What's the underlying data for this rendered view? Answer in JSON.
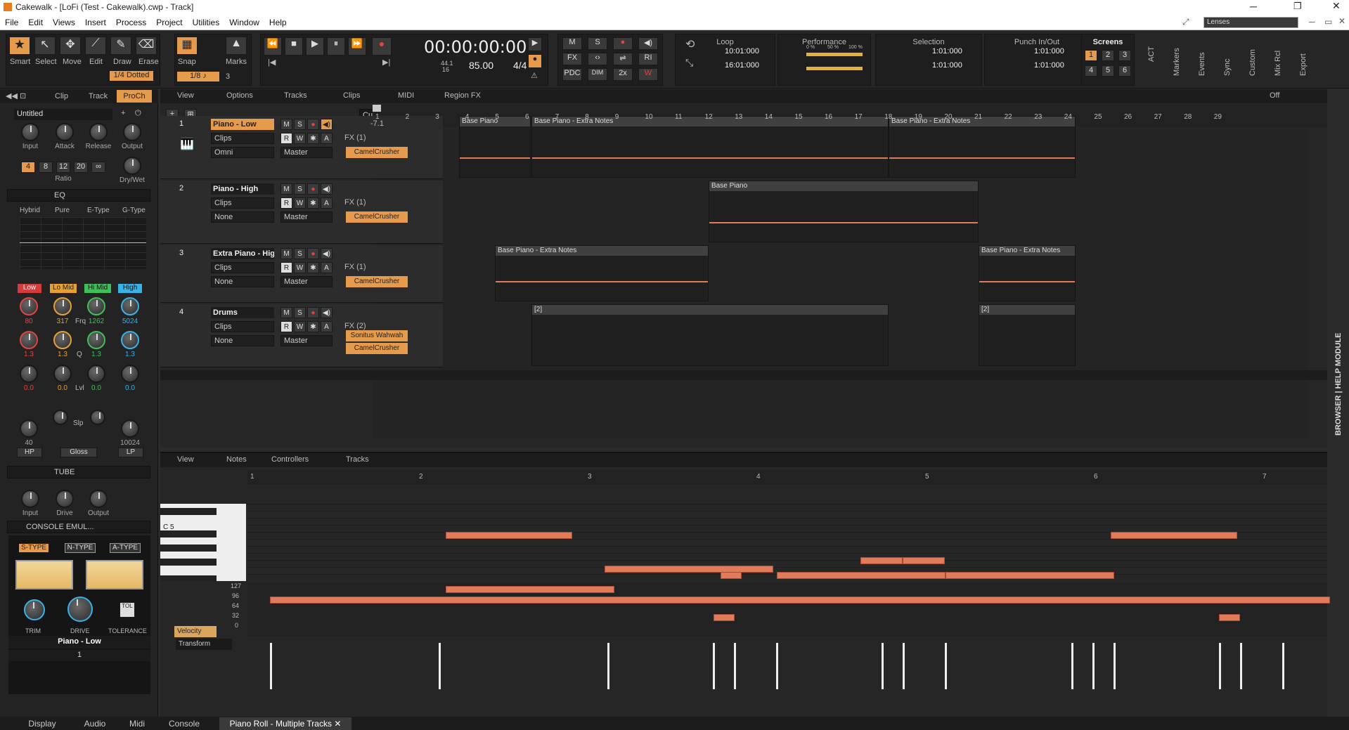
{
  "titlebar": {
    "title": "Cakewalk - [LoFi (Test - Cakewalk).cwp - Track]"
  },
  "menu": [
    "File",
    "Edit",
    "Views",
    "Insert",
    "Process",
    "Project",
    "Utilities",
    "Window",
    "Help"
  ],
  "tools": {
    "labels": [
      "Smart",
      "Select",
      "Move",
      "Edit",
      "Draw",
      "Erase"
    ],
    "snap": "Snap",
    "marks": "Marks",
    "snap_value": "1/8",
    "snap_num": "3",
    "dotted": "1/4 Dotted"
  },
  "transport": {
    "time": "00:00:00:00",
    "sample_rate": "44.1",
    "bit_depth": "16",
    "tempo": "85.00",
    "meter": "4/4"
  },
  "mix": {
    "m": "M",
    "s": "S",
    "fx": "FX",
    "pdc": "PDC",
    "ri": "RI",
    "dim": "DIM",
    "x2": "2x"
  },
  "loop": {
    "title": "Loop",
    "start": "10:01:000",
    "end": "16:01:000"
  },
  "performance": {
    "title": "Performance",
    "pct1": "0 %",
    "pct2": "50 %",
    "pct3": "100 %"
  },
  "selection": {
    "title": "Selection",
    "start": "1:01:000",
    "end": "1:01:000"
  },
  "punch": {
    "title": "Punch In/Out",
    "start": "1:01:000",
    "end": "1:01:000"
  },
  "screensets": {
    "title": "Screens",
    "nums": [
      "1",
      "2",
      "3",
      "4",
      "5",
      "6"
    ]
  },
  "side_modules": [
    "ACT",
    "Markers",
    "Events",
    "Sync",
    "Custom",
    "Mix Rcl",
    "Export"
  ],
  "lenses": "Lenses",
  "inspector": {
    "tabs": [
      "Clip",
      "Track",
      "ProCh"
    ],
    "preset": "Untitled",
    "comp_labels": [
      "Input",
      "Attack",
      "Release",
      "Output"
    ],
    "ratios": [
      "4",
      "8",
      "12",
      "20",
      "∞"
    ],
    "ratio_label": "Ratio",
    "drywet": "Dry/Wet",
    "eq_title": "EQ",
    "eq_modes": [
      "Hybrid",
      "Pure",
      "E-Type",
      "G-Type"
    ],
    "eq_bands": [
      "Low",
      "Lo Mid",
      "Hi Mid",
      "High"
    ],
    "eq_freq": [
      "80",
      "317",
      "1262",
      "5024"
    ],
    "eq_q": [
      "1.3",
      "1.3",
      "1.3",
      "1.3"
    ],
    "eq_gain": [
      "0.0",
      "0.0",
      "0.0",
      "0.0"
    ],
    "frq": "Frq",
    "q": "Q",
    "lvl": "Lvl",
    "slp": "Slp",
    "hp_val": "40",
    "lp_val": "10024",
    "hp": "HP",
    "gloss": "Gloss",
    "lp": "LP",
    "tube_title": "TUBE",
    "tube_labels": [
      "Input",
      "Drive",
      "Output"
    ],
    "console_title": "CONSOLE EMUL...",
    "console_types": [
      "S-TYPE",
      "N-TYPE",
      "A-TYPE"
    ],
    "console_knobs": [
      "TRIM",
      "DRIVE",
      "TOLERANCE"
    ],
    "tol": "TOL",
    "track_name": "Piano - Low",
    "track_num": "1",
    "bottom": [
      "Display",
      "Audio",
      "Midi"
    ]
  },
  "track_view_menu": [
    "View",
    "Options",
    "Tracks",
    "Clips",
    "MIDI",
    "Region FX"
  ],
  "custom_dropdown": "Custom",
  "ruler": [
    "1",
    "2",
    "3",
    "4",
    "5",
    "6",
    "7",
    "8",
    "9",
    "10",
    "11",
    "12",
    "13",
    "14",
    "15",
    "16",
    "17",
    "18",
    "19",
    "20",
    "21",
    "22",
    "23",
    "24",
    "25",
    "26",
    "27",
    "28",
    "29"
  ],
  "off": "Off",
  "tracks": [
    {
      "num": "1",
      "name": "Piano - Low",
      "vol": "-7.1",
      "input": "Clips",
      "channel": "Omni",
      "output": "Master",
      "fx": "FX (1)",
      "plugins": [
        "CamelCrusher"
      ]
    },
    {
      "num": "2",
      "name": "Piano - High",
      "vol": "",
      "input": "Clips",
      "channel": "None",
      "output": "Master",
      "fx": "FX (1)",
      "plugins": [
        "CamelCrusher"
      ]
    },
    {
      "num": "3",
      "name": "Extra Piano - Hig",
      "vol": "",
      "input": "Clips",
      "channel": "None",
      "output": "Master",
      "fx": "FX (1)",
      "plugins": [
        "CamelCrusher"
      ]
    },
    {
      "num": "4",
      "name": "Drums",
      "vol": "",
      "input": "Clips",
      "channel": "None",
      "output": "Master",
      "fx": "FX (2)",
      "plugins": [
        "Sonitus Wahwah",
        "CamelCrusher"
      ]
    }
  ],
  "clips": {
    "base_piano": "Base Piano",
    "extra_notes": "Base Piano - Extra Notes",
    "drum_clip": "[2]"
  },
  "pianoroll": {
    "menu": [
      "View",
      "Notes",
      "Controllers",
      "Tracks"
    ],
    "ruler": [
      "1",
      "2",
      "3",
      "4",
      "5",
      "6",
      "7"
    ],
    "c5": "C 5",
    "vel_scale": [
      "127",
      "96",
      "64",
      "32",
      "0"
    ],
    "velocity": "Velocity",
    "transform": "Transform"
  },
  "bottom_tabs": [
    "Console",
    "Piano Roll - Multiple Tracks"
  ],
  "browser": "BROWSER | HELP MODULE"
}
